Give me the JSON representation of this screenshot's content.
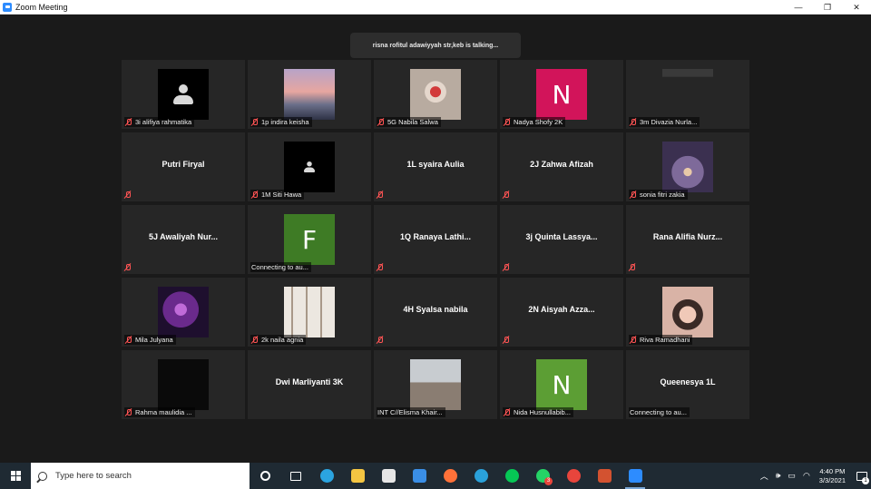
{
  "window": {
    "title": "Zoom Meeting",
    "controls": [
      "—",
      "❐",
      "✕"
    ]
  },
  "talking_indicator": "risna rofitul adawiyyah str,keb is talking...",
  "participants": [
    {
      "name": "3i alifiya rahmatika",
      "muted": true,
      "video": "default-avatar"
    },
    {
      "name": "1p indira keisha",
      "muted": true,
      "video": "photo-sunset",
      "bg": "#9a86a8"
    },
    {
      "name": "5G Nabila Salwa",
      "muted": true,
      "video": "photo-person",
      "bg": "#c7b7a8"
    },
    {
      "name": "Nadya Shofy 2K",
      "muted": true,
      "video": "letter",
      "letter": "N",
      "bg": "#d2145a"
    },
    {
      "name": "3m Divazia Nurla...",
      "muted": true,
      "video": "photo-dark",
      "bg": "#2a2a2a"
    },
    {
      "name": "Putri Firyal",
      "muted": true,
      "video": "name-only"
    },
    {
      "name": "1M Siti Hawa",
      "muted": true,
      "video": "default-avatar-small"
    },
    {
      "name": "1L syaira Aulia",
      "muted": true,
      "video": "name-only"
    },
    {
      "name": "2J Zahwa Afizah",
      "muted": true,
      "video": "name-only"
    },
    {
      "name": "sonia fitri zakia",
      "muted": true,
      "video": "photo-night",
      "bg": "#5a4a6e"
    },
    {
      "name": "5J Awaliyah Nur...",
      "muted": true,
      "video": "name-only"
    },
    {
      "name": "Connecting to au...",
      "muted": false,
      "video": "letter",
      "letter": "F",
      "bg": "#3e7b25"
    },
    {
      "name": "1Q Ranaya Lathi...",
      "muted": true,
      "video": "name-only"
    },
    {
      "name": "3j Quinta Lassya...",
      "muted": true,
      "video": "name-only"
    },
    {
      "name": "Rana Alifia Nurz...",
      "muted": true,
      "video": "name-only"
    },
    {
      "name": "Mila Julyana",
      "muted": true,
      "video": "photo-purple",
      "bg": "#4b1f6e"
    },
    {
      "name": "2k naila agnia",
      "muted": true,
      "video": "photo-group",
      "bg": "#d8d0c8"
    },
    {
      "name": "4H Syalsa nabila",
      "muted": true,
      "video": "name-only"
    },
    {
      "name": "2N Aisyah Azza...",
      "muted": true,
      "video": "name-only"
    },
    {
      "name": "Riva Ramadhani",
      "muted": true,
      "video": "photo-portrait",
      "bg": "#c9a89a"
    },
    {
      "name": "Rahma maulidia ...",
      "muted": true,
      "video": "photo-black",
      "bg": "#0a0a0a"
    },
    {
      "name": "Dwi Marliyanti 3K",
      "muted": false,
      "video": "name-only"
    },
    {
      "name": "INT C//Elisma Khair...",
      "muted": false,
      "video": "photo-beach",
      "bg": "#8a8f94"
    },
    {
      "name": "Nida Husnullabib...",
      "muted": true,
      "video": "letter",
      "letter": "N",
      "bg": "#5c9e34"
    },
    {
      "name": "Queenesya 1L",
      "muted": false,
      "video": "name-only",
      "status": "Connecting to au..."
    }
  ],
  "taskbar": {
    "search_placeholder": "Type here to search",
    "apps": [
      {
        "name": "cortana-icon",
        "color": "#ffffff"
      },
      {
        "name": "task-view-icon",
        "color": "#ffffff"
      },
      {
        "name": "edge-icon",
        "color": "#2ba4e0"
      },
      {
        "name": "file-explorer-icon",
        "color": "#f4c542"
      },
      {
        "name": "store-icon",
        "color": "#e6e6e6"
      },
      {
        "name": "mail-icon",
        "color": "#3a8ee6"
      },
      {
        "name": "firefox-icon",
        "color": "#ff7139"
      },
      {
        "name": "telegram-icon",
        "color": "#2aa1da"
      },
      {
        "name": "line-icon",
        "color": "#06c755"
      },
      {
        "name": "whatsapp-icon",
        "color": "#25d366",
        "badge": "3"
      },
      {
        "name": "chrome-icon",
        "color": "#e8453c"
      },
      {
        "name": "powerpoint-icon",
        "color": "#d35230"
      },
      {
        "name": "zoom-icon",
        "color": "#2d8cff",
        "active": true
      }
    ],
    "time": "4:40 PM",
    "date": "3/3/2021",
    "notifications": "1"
  }
}
